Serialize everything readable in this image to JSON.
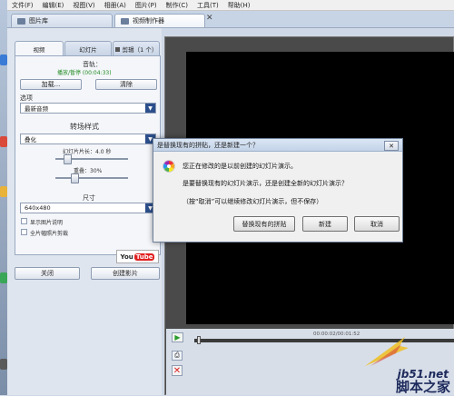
{
  "menubar": {
    "items": [
      "文件(F)",
      "编辑(E)",
      "视图(V)",
      "相册(A)",
      "图片(P)",
      "制作(C)",
      "工具(T)",
      "帮助(H)"
    ]
  },
  "tabs": [
    {
      "label": "图片库"
    },
    {
      "label": "视频制作器"
    }
  ],
  "tab_close": "✕",
  "left": {
    "inner_tabs": [
      "视频",
      "幻灯片",
      "剪辑（1 个）"
    ],
    "audio_title": "音轨：",
    "audio_status": "播放/暂停 (00:04:33)",
    "add_label": "加载...",
    "clear_label": "清除",
    "option_label": "选项",
    "option_value": "最新音频",
    "transition_title": "转场样式",
    "transition_value": "叠化",
    "duration_label": "幻灯片片长：4.0 秒",
    "overlap_label": "重叠：30%",
    "size_title": "尺寸",
    "size_value": "640x480",
    "check1": "显示图片说明",
    "check2": "全片幅照片剪裁",
    "close_label": "关闭",
    "create_label": "创建影片",
    "youtube_you": "You",
    "youtube_tube": "Tube"
  },
  "player": {
    "timecode": "00:00:02/00:01:52"
  },
  "dialog": {
    "title": "是替换现有的拼贴，还是新建一个？",
    "line1": "您正在修改的是以前创建的幻灯片演示。",
    "line2": "是要替换现有的幻灯片演示，还是创建全新的幻灯片演示？",
    "line3": "（按“取消”可以继续修改幻灯片演示，但不保存）",
    "btn_replace": "替换现有的拼贴",
    "btn_new": "新建",
    "btn_cancel": "取消",
    "close": "✕"
  },
  "watermark": {
    "url": "jb51.net",
    "name": "脚本之家"
  },
  "colors": {
    "accent": "#2c4f8c",
    "green_status": "#1f8a1f",
    "stage_bg": "#000000"
  }
}
